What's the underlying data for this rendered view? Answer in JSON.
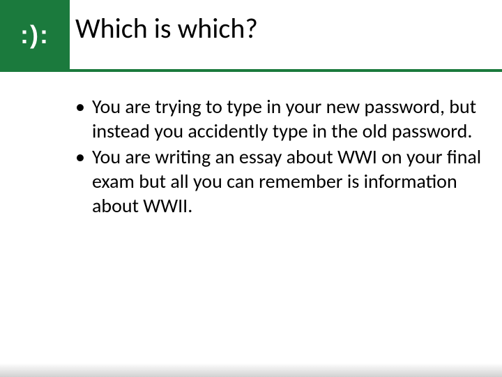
{
  "logo": ":):",
  "title": "Which is which?",
  "bullets": [
    "You are trying to type in your new password, but instead you accidently type in the old password.",
    "You are writing an essay about WWI on your final exam but all you can remember is information about WWII."
  ]
}
